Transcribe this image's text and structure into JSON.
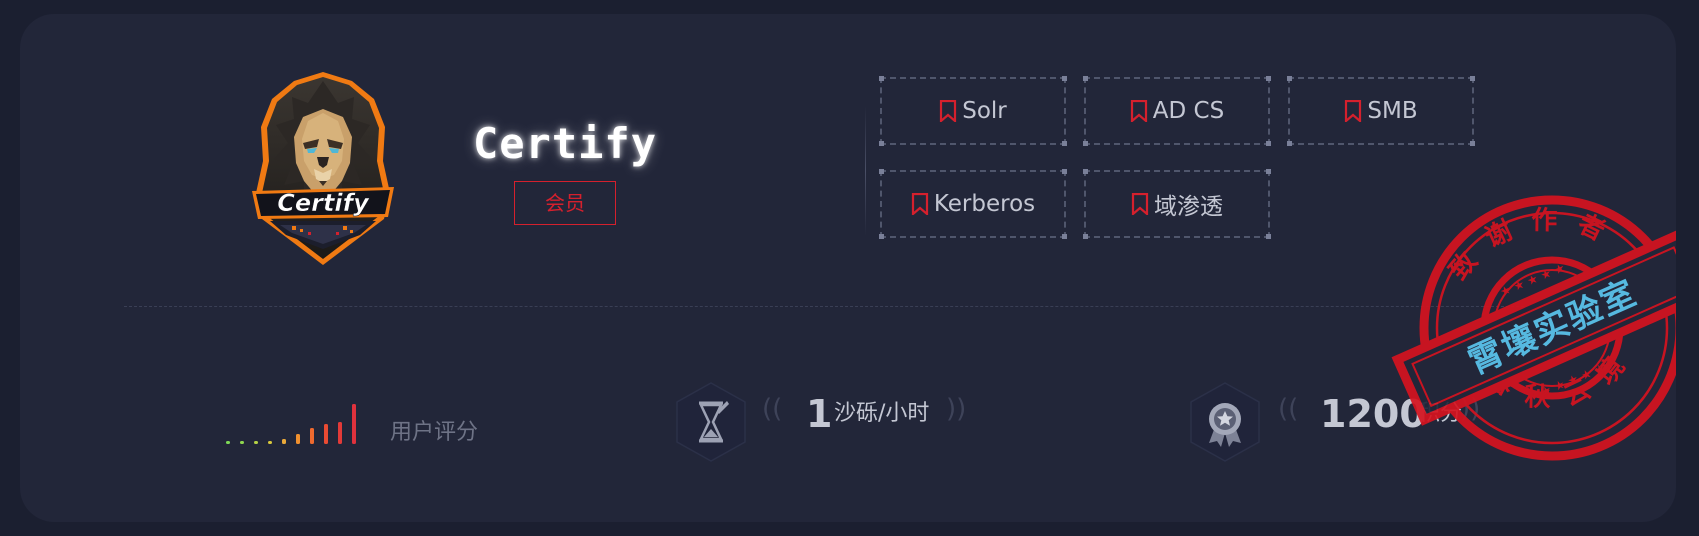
{
  "machine": {
    "name": "Certify",
    "logo_text": "Certify",
    "badge": "会员"
  },
  "tags": [
    {
      "label": "Solr"
    },
    {
      "label": "AD CS"
    },
    {
      "label": "SMB"
    },
    {
      "label": "Kerberos"
    },
    {
      "label": "域渗透"
    }
  ],
  "rating": {
    "label": "用户评分",
    "bar_count": 10,
    "filled_bars": 5
  },
  "stats": {
    "time": {
      "value": "1",
      "unit": "沙砾/小时"
    },
    "points": {
      "value": "1200",
      "unit": "积分"
    }
  },
  "stamp": {
    "center_text": "霄壤实验室",
    "top_text": "致谢作者",
    "bottom_text": "春秋云境"
  },
  "colors": {
    "background": "#1b1f30",
    "card": "#222639",
    "accent_red": "#d5202d",
    "tag_text": "#c4c7d3"
  }
}
